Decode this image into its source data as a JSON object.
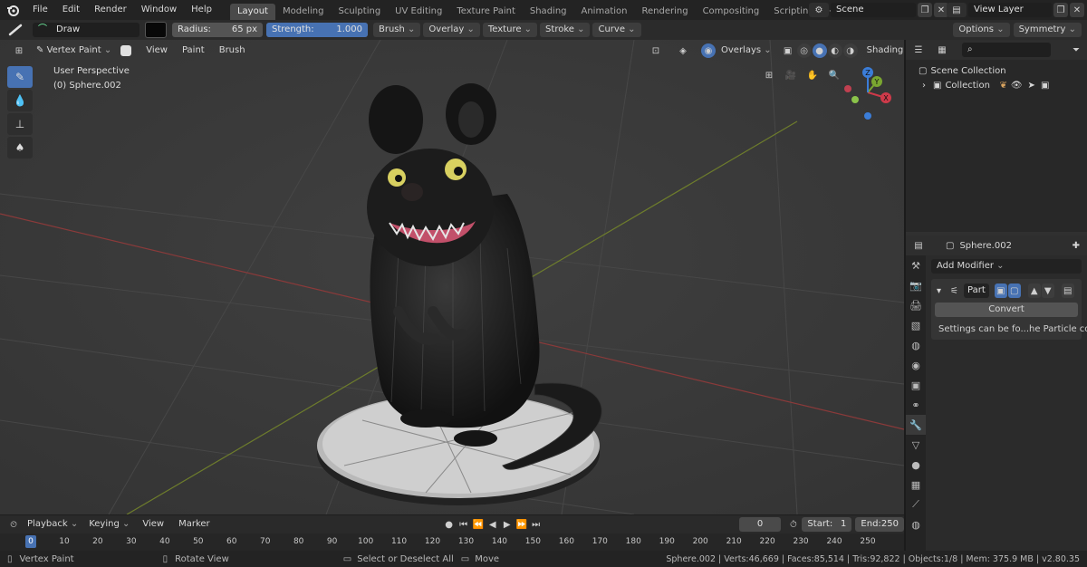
{
  "menu": {
    "items": [
      "File",
      "Edit",
      "Render",
      "Window",
      "Help"
    ],
    "workspaces": [
      "Layout",
      "Modeling",
      "Sculpting",
      "UV Editing",
      "Texture Paint",
      "Shading",
      "Animation",
      "Rendering",
      "Compositing",
      "Scripting"
    ],
    "active_workspace": "Layout",
    "add_tab": "+",
    "scene": "Scene",
    "view_layer": "View Layer"
  },
  "tool_settings": {
    "brush_name": "Draw",
    "radius_label": "Radius:",
    "radius_value": "65 px",
    "strength_label": "Strength:",
    "strength_value": "1.000",
    "strength_fill": 1.0,
    "dropdowns": [
      "Brush",
      "Overlay",
      "Texture",
      "Stroke",
      "Curve"
    ],
    "options": "Options",
    "symmetry": "Symmetry",
    "color": "#080808"
  },
  "viewport": {
    "mode": "Vertex Paint",
    "menus": [
      "View",
      "Paint",
      "Brush"
    ],
    "perspective": "User Perspective",
    "object": "(0) Sphere.002",
    "overlays": "Overlays",
    "shading": "Shading",
    "gizmo": {
      "x": "X",
      "y": "Y",
      "z": "Z"
    }
  },
  "outliner": {
    "scene_collection": "Scene Collection",
    "collection": "Collection"
  },
  "properties": {
    "object_name": "Sphere.002",
    "add_modifier": "Add Modifier",
    "modifier_name": "Part",
    "convert_button": "Convert",
    "info_text": "Settings can be fo...he Particle context"
  },
  "timeline": {
    "menus": [
      "Playback",
      "Keying",
      "View",
      "Marker"
    ],
    "current_frame": "0",
    "start_label": "Start:",
    "start_value": "1",
    "end_label": "End:",
    "end_value": "250",
    "ticks": [
      "0",
      "10",
      "20",
      "30",
      "40",
      "50",
      "60",
      "70",
      "80",
      "90",
      "100",
      "110",
      "120",
      "130",
      "140",
      "150",
      "160",
      "170",
      "180",
      "190",
      "200",
      "210",
      "220",
      "230",
      "240",
      "250"
    ]
  },
  "statusbar": {
    "left": "Vertex Paint",
    "middle1": "Rotate View",
    "middle2": "Select or Deselect All",
    "middle3": "Move",
    "stats": "Sphere.002 | Verts:46,669 | Faces:85,514 | Tris:92,822 | Objects:1/8 | Mem: 375.9 MB | v2.80.35"
  },
  "colors": {
    "accent": "#4772b3",
    "header": "#232323",
    "viewport_bg": "#3a3a3a"
  }
}
